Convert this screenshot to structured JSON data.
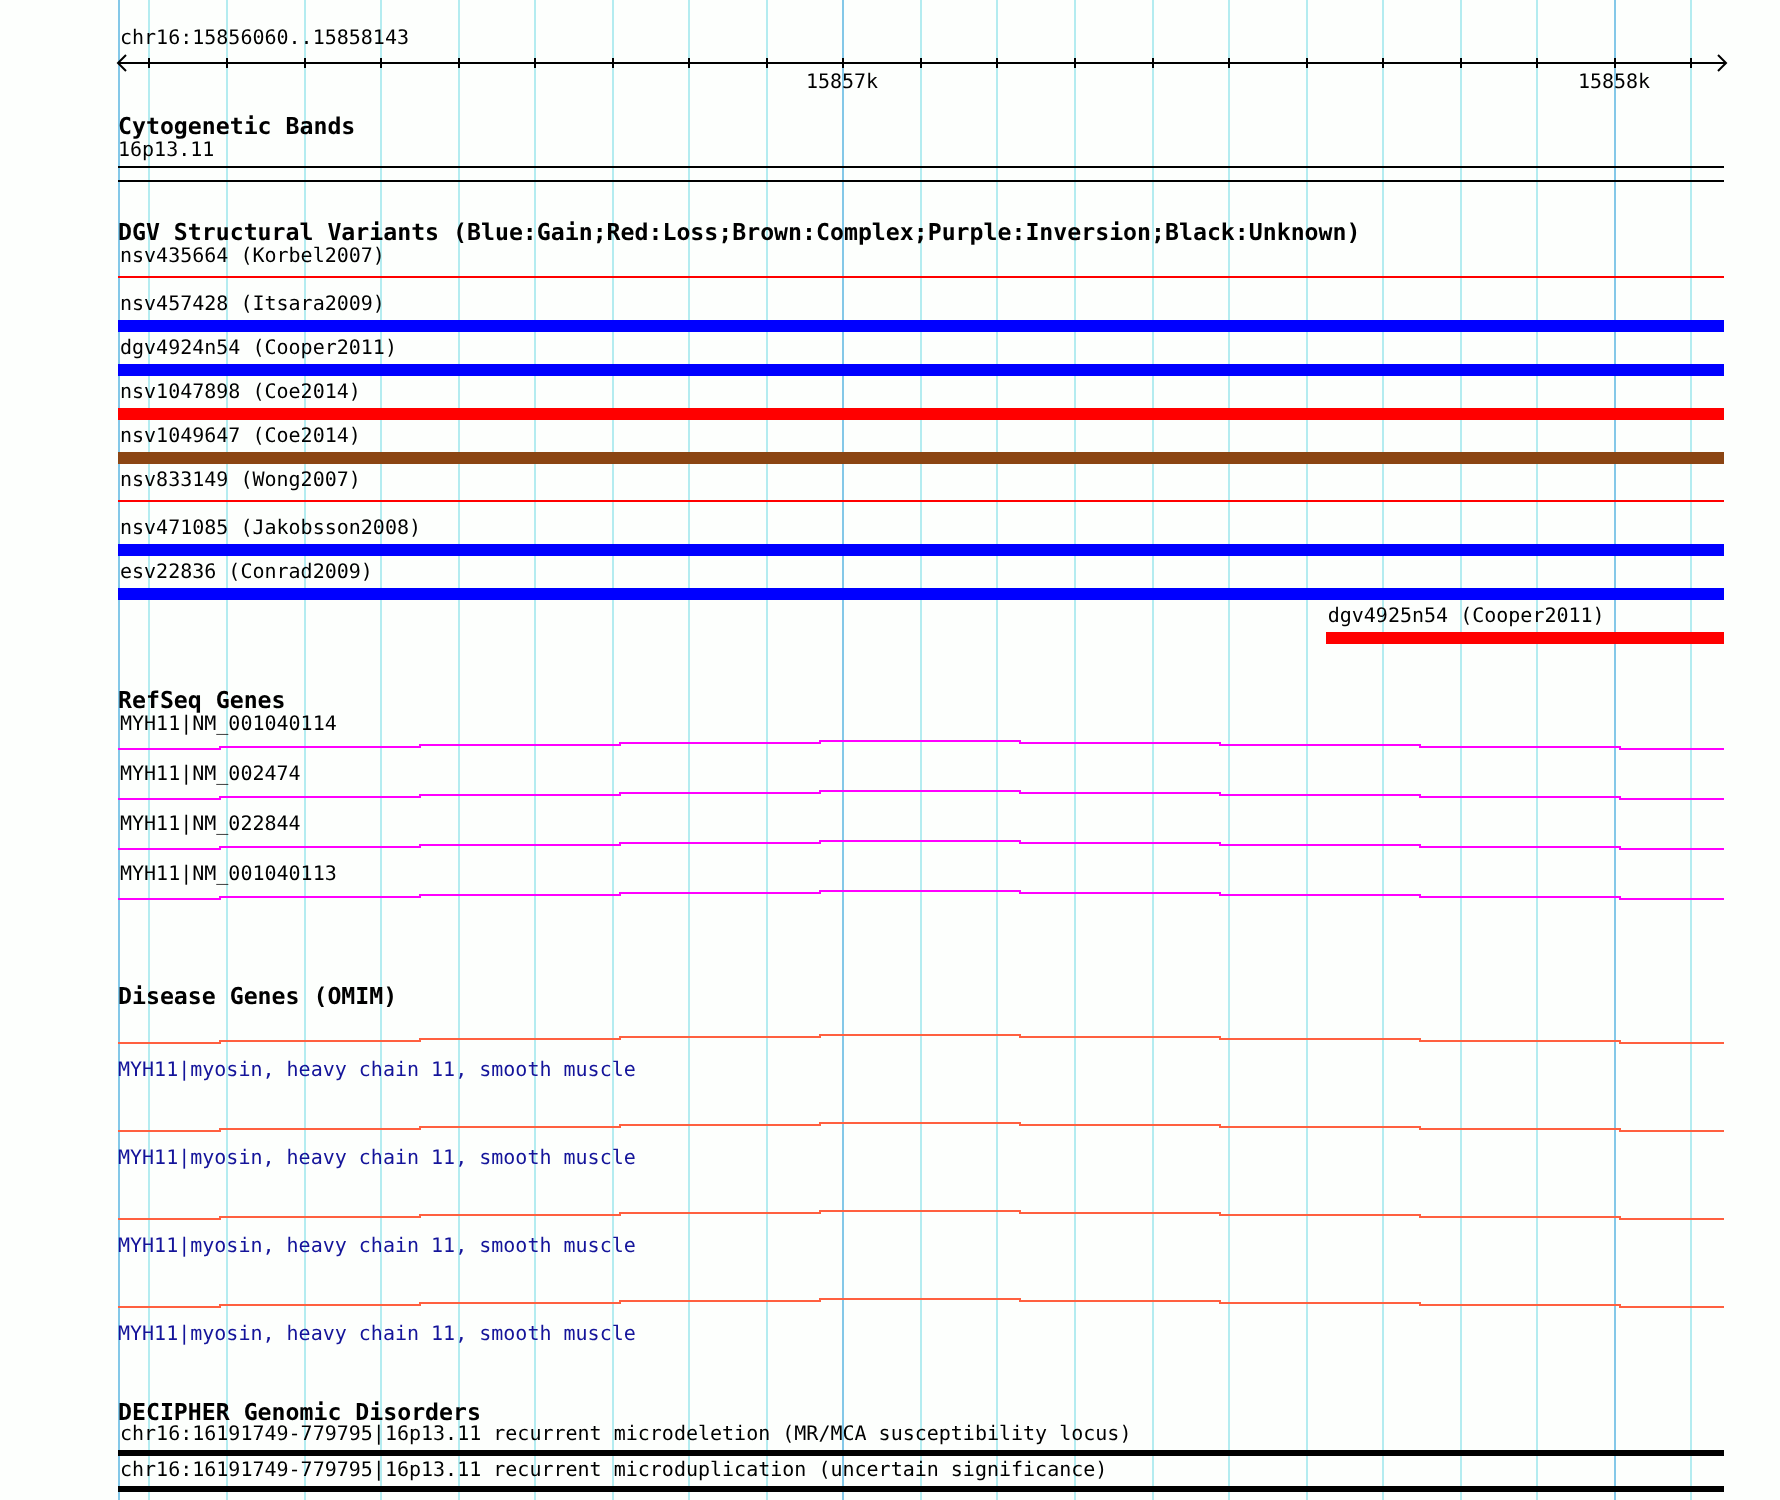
{
  "ruler": {
    "location": "chr16:15856060..15858143",
    "ticks": [
      "15857k",
      "15858k"
    ]
  },
  "cytogenetic_bands": {
    "title": "Cytogenetic Bands",
    "band": "16p13.11"
  },
  "dgv": {
    "title": "DGV Structural Variants (Blue:Gain;Red:Loss;Brown:Complex;Purple:Inversion;Black:Unknown)",
    "variants": [
      {
        "label": "nsv435664 (Korbel2007)",
        "color": "#ff0000",
        "kind": "thin",
        "partial": false
      },
      {
        "label": "nsv457428 (Itsara2009)",
        "color": "#0000ff",
        "kind": "thick",
        "partial": false
      },
      {
        "label": "dgv4924n54 (Cooper2011)",
        "color": "#0000ff",
        "kind": "thick",
        "partial": false
      },
      {
        "label": "nsv1047898 (Coe2014)",
        "color": "#ff0000",
        "kind": "thick",
        "partial": false
      },
      {
        "label": "nsv1049647 (Coe2014)",
        "color": "#8b4513",
        "kind": "thick",
        "partial": false
      },
      {
        "label": "nsv833149 (Wong2007)",
        "color": "#ff0000",
        "kind": "thin",
        "partial": false
      },
      {
        "label": "nsv471085 (Jakobsson2008)",
        "color": "#0000ff",
        "kind": "thick",
        "partial": false
      },
      {
        "label": "esv22836 (Conrad2009)",
        "color": "#0000ff",
        "kind": "thick",
        "partial": false
      },
      {
        "label": "dgv4925n54 (Cooper2011)",
        "color": "#ff0000",
        "kind": "thick",
        "partial": true
      }
    ]
  },
  "refseq_genes": {
    "title": "RefSeq Genes",
    "genes": [
      {
        "label": "MYH11|NM_001040114"
      },
      {
        "label": "MYH11|NM_002474"
      },
      {
        "label": "MYH11|NM_022844"
      },
      {
        "label": "MYH11|NM_001040113"
      }
    ]
  },
  "disease_genes": {
    "title": "Disease Genes (OMIM)",
    "genes": [
      {
        "label": "MYH11|myosin, heavy chain 11, smooth muscle"
      },
      {
        "label": "MYH11|myosin, heavy chain 11, smooth muscle"
      },
      {
        "label": "MYH11|myosin, heavy chain 11, smooth muscle"
      },
      {
        "label": "MYH11|myosin, heavy chain 11, smooth muscle"
      }
    ]
  },
  "decipher": {
    "title": "DECIPHER Genomic Disorders",
    "disorders": [
      {
        "label": "chr16:16191749-779795|16p13.11 recurrent microdeletion (MR/MCA susceptibility locus)"
      },
      {
        "label": "chr16:16191749-779795|16p13.11 recurrent microduplication (uncertain significance)"
      }
    ]
  }
}
